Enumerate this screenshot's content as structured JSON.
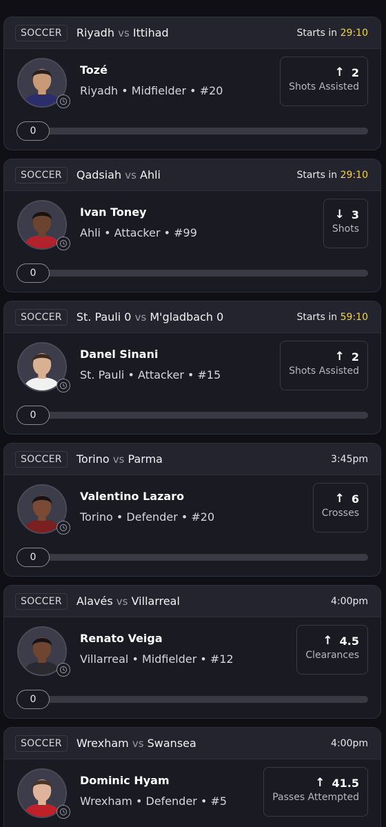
{
  "cards": [
    {
      "sport": "SOCCER",
      "home": "Riyadh",
      "vs": "vs",
      "away": "Ittihad",
      "start_prefix": "Starts in",
      "start_time": "29:10",
      "player": {
        "name": "Tozé",
        "info": "Riyadh • Midfielder • #20",
        "skin": "#c99a78",
        "hair": "#2a1e18",
        "kit": "#2b2e6b"
      },
      "stat": {
        "direction": "up",
        "arrow": "↑",
        "value": "2",
        "label": "Shots Assisted"
      },
      "progress": {
        "label": "0",
        "value": 0
      }
    },
    {
      "sport": "SOCCER",
      "home": "Qadsiah",
      "vs": "vs",
      "away": "Ahli",
      "start_prefix": "Starts in",
      "start_time": "29:10",
      "player": {
        "name": "Ivan Toney",
        "info": "Ahli • Attacker • #99",
        "skin": "#6b4430",
        "hair": "#1a1210",
        "kit": "#b3222c"
      },
      "stat": {
        "direction": "down",
        "arrow": "↓",
        "value": "3",
        "label": "Shots"
      },
      "progress": {
        "label": "0",
        "value": 0
      }
    },
    {
      "sport": "SOCCER",
      "home": "St. Pauli",
      "home_score": "0",
      "vs": "vs",
      "away": "M'gladbach",
      "away_score": "0",
      "start_prefix": "Starts in",
      "start_time": "59:10",
      "player": {
        "name": "Danel Sinani",
        "info": "St. Pauli • Attacker • #15",
        "skin": "#d8b092",
        "hair": "#3a2a20",
        "kit": "#f1f1f1"
      },
      "stat": {
        "direction": "up",
        "arrow": "↑",
        "value": "2",
        "label": "Shots Assisted"
      },
      "progress": {
        "label": "0",
        "value": 0
      }
    },
    {
      "sport": "SOCCER",
      "home": "Torino",
      "vs": "vs",
      "away": "Parma",
      "start_prefix": "",
      "start_time": "3:45pm",
      "player": {
        "name": "Valentino Lazaro",
        "info": "Torino • Defender • #20",
        "skin": "#7a4a34",
        "hair": "#1a1210",
        "kit": "#7a2020"
      },
      "stat": {
        "direction": "up",
        "arrow": "↑",
        "value": "6",
        "label": "Crosses"
      },
      "progress": {
        "label": "0",
        "value": 0
      }
    },
    {
      "sport": "SOCCER",
      "home": "Alavés",
      "vs": "vs",
      "away": "Villarreal",
      "start_prefix": "",
      "start_time": "4:00pm",
      "player": {
        "name": "Renato Veiga",
        "info": "Villarreal • Midfielder • #12",
        "skin": "#6e4630",
        "hair": "#1a1210",
        "kit": "#2a2a30"
      },
      "stat": {
        "direction": "up",
        "arrow": "↑",
        "value": "4.5",
        "label": "Clearances"
      },
      "progress": {
        "label": "0",
        "value": 0
      }
    },
    {
      "sport": "SOCCER",
      "home": "Wrexham",
      "vs": "vs",
      "away": "Swansea",
      "start_prefix": "",
      "start_time": "4:00pm",
      "player": {
        "name": "Dominic Hyam",
        "info": "Wrexham • Defender • #5",
        "skin": "#e0b49a",
        "hair": "#4a3426",
        "kit": "#c0202a"
      },
      "stat": {
        "direction": "up",
        "arrow": "↑",
        "value": "41.5",
        "label": "Passes Attempted"
      },
      "progress": {
        "label": "0",
        "value": 0
      }
    }
  ]
}
